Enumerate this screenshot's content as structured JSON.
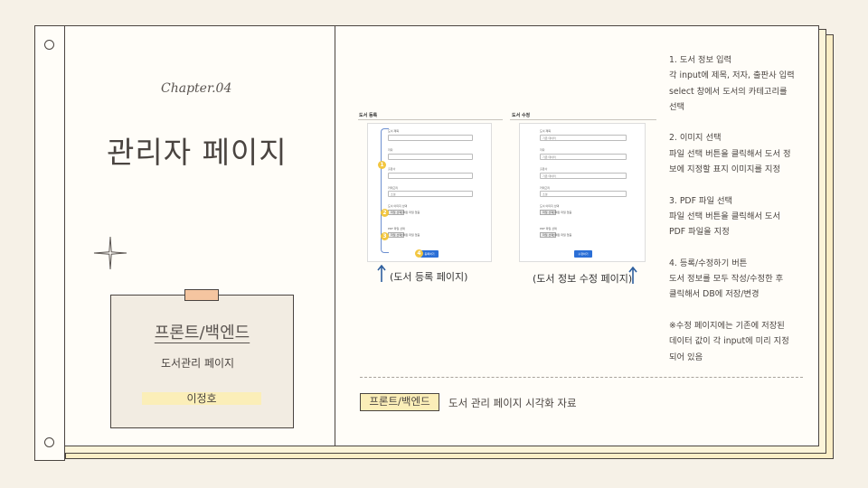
{
  "left_page": {
    "chapter": "Chapter.04",
    "title": "관리자 페이지",
    "card": {
      "title": "프론트/백엔드",
      "subtitle": "도서관리 페이지",
      "author": "이정호"
    }
  },
  "screenshots": {
    "register": {
      "header": "도서 등록",
      "caption": "(도서 등록 페이지)",
      "fields": [
        "도서 제목",
        "저자",
        "출판사",
        "카테고리"
      ],
      "category_value": "소설",
      "image_label": "도서 이미지 선택",
      "pdf_label": "PDF 파일 선택",
      "file_button": "파일 선택",
      "file_status": "선택된 파일 없음",
      "badges": [
        "1",
        "2",
        "3",
        "4"
      ],
      "submit": "등록하기"
    },
    "edit": {
      "header": "도서 수정",
      "caption": "(도서 정보 수정 페이지)",
      "fields": [
        "도서 제목",
        "저자",
        "출판사",
        "카테고리"
      ],
      "values": [
        "기존 데이터",
        "기존 데이터",
        "기존 데이터",
        "소설"
      ],
      "image_label": "도서 이미지 선택",
      "pdf_label": "PDF 파일 선택",
      "file_button": "파일 선택",
      "file_status": "선택된 파일 없음",
      "submit": "수정하기"
    }
  },
  "description": [
    "1. 도서 정보 입력",
    "각 input에 제목, 저자, 출판사 입력",
    "select 창에서 도서의 카테고리를",
    "선택",
    "",
    "2. 이미지 선택",
    "파일 선택 버튼을 클릭해서 도서 정",
    "보에 지정할 표지 이미지를 지정",
    "",
    "3. PDF 파일 선택",
    "파일 선택 버튼을 클릭해서 도서",
    "PDF 파일을 지정",
    "",
    "4. 등록/수정하기 버튼",
    "도서 정보를 모두 작성/수정한 후",
    "클릭해서 DB에 저장/변경",
    "",
    " ※수정 페이지에는 기존에 저장된",
    "데이터 값이 각 input에 미리 지정",
    "되어 있음"
  ],
  "footer": {
    "tag": "프론트/백엔드",
    "caption": "도서 관리 페이지 시각화 자료"
  },
  "colors": {
    "background": "#f6f1e7",
    "page": "#fffdf8",
    "line": "#4a4440",
    "highlight": "#fbeeb8",
    "tape": "#f5c5a0",
    "badge": "#f2c640",
    "arrow": "#2e5f9e"
  }
}
